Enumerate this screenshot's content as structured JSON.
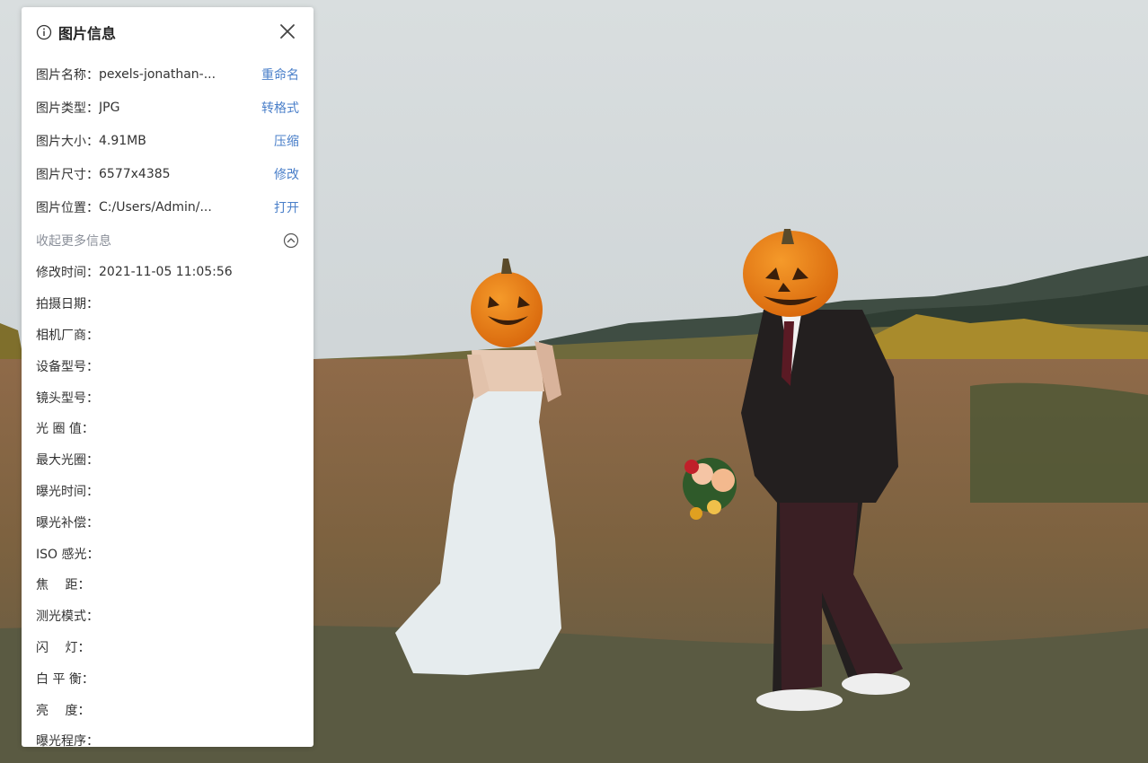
{
  "panel": {
    "title": "图片信息",
    "basic_rows": [
      {
        "label": "图片名称：",
        "value": "pexels-jonathan-...",
        "action": "重命名"
      },
      {
        "label": "图片类型：",
        "value": "JPG",
        "action": "转格式"
      },
      {
        "label": "图片大小：",
        "value": "4.91MB",
        "action": "压缩"
      },
      {
        "label": "图片尺寸：",
        "value": "6577x4385",
        "action": "修改"
      },
      {
        "label": "图片位置：",
        "value": "C:/Users/Admin/...",
        "action": "打开"
      }
    ],
    "toggle_label": "收起更多信息",
    "exif_rows": [
      {
        "label": "修改时间：",
        "value": "2021-11-05 11:05:56"
      },
      {
        "label": "拍摄日期：",
        "value": ""
      },
      {
        "label": "相机厂商：",
        "value": ""
      },
      {
        "label": "设备型号：",
        "value": ""
      },
      {
        "label": "镜头型号：",
        "value": ""
      },
      {
        "label": "光 圈 值：",
        "value": ""
      },
      {
        "label": "最大光圈：",
        "value": ""
      },
      {
        "label": "曝光时间：",
        "value": ""
      },
      {
        "label": "曝光补偿：",
        "value": ""
      },
      {
        "label": "ISO 感光：",
        "value": ""
      },
      {
        "label": "焦　 距：",
        "value": ""
      },
      {
        "label": "测光模式：",
        "value": ""
      },
      {
        "label": "闪　 灯：",
        "value": ""
      },
      {
        "label": "白 平 衡：",
        "value": ""
      },
      {
        "label": "亮　 度：",
        "value": ""
      },
      {
        "label": "曝光程序：",
        "value": ""
      }
    ]
  },
  "colors": {
    "link": "#4a7fc9",
    "muted": "#8a8f99",
    "text": "#333333",
    "panel_bg": "#ffffff"
  },
  "icons": {
    "header": "info-icon",
    "close": "close-icon",
    "toggle": "chevron-up-circle-icon"
  }
}
